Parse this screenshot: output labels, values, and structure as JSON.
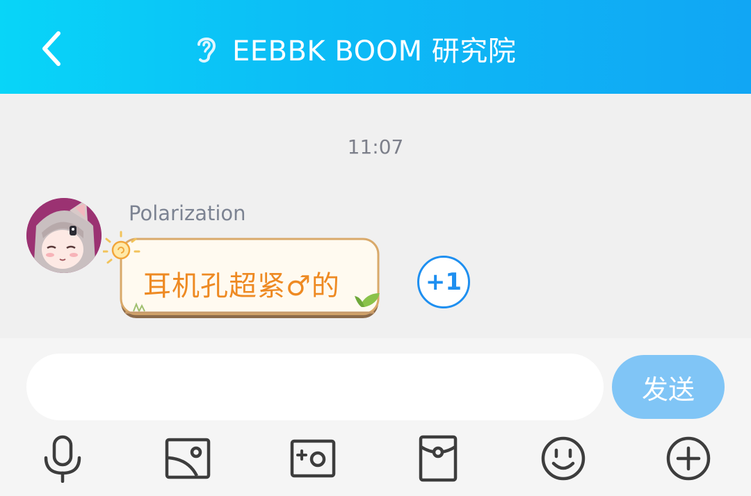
{
  "header": {
    "title": "EEBBK BOOM 研究院",
    "back_icon": "chevron-left-icon",
    "title_icon": "ear-icon"
  },
  "chat": {
    "timestamp": "11:07",
    "messages": [
      {
        "sender": "Polarization",
        "text": "耳机孔超紧♂的",
        "reaction": "+1"
      }
    ]
  },
  "composer": {
    "input_value": "",
    "send_label": "发送"
  },
  "toolbar": {
    "icons": [
      "microphone-icon",
      "image-icon",
      "camera-icon",
      "red-packet-icon",
      "emoji-icon",
      "plus-icon"
    ]
  },
  "colors": {
    "header_start": "#08d5f8",
    "header_end": "#11a6f4",
    "message_text": "#ee8a23",
    "accent_blue": "#1e8ff0",
    "send_button": "#80c5f6"
  }
}
